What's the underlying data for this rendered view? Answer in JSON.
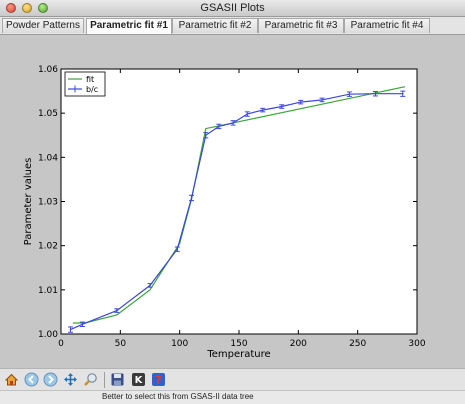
{
  "window": {
    "title": "GSASII Plots"
  },
  "tabs": [
    {
      "label": "Powder Patterns"
    },
    {
      "label": "Parametric fit #1"
    },
    {
      "label": "Parametric fit #2"
    },
    {
      "label": "Parametric fit #3"
    },
    {
      "label": "Parametric fit #4"
    }
  ],
  "active_tab": 1,
  "toolbar": {
    "buttons": [
      {
        "icon": "home-icon"
      },
      {
        "icon": "back-arrow-icon"
      },
      {
        "icon": "forward-arrow-icon"
      },
      {
        "icon": "pan-icon"
      },
      {
        "icon": "zoom-icon"
      },
      {
        "icon": "save-icon"
      },
      {
        "icon": "k-icon"
      },
      {
        "icon": "help-icon"
      }
    ]
  },
  "status": {
    "text": "Better to select this from GSAS-II data tree"
  },
  "chart_data": {
    "type": "line",
    "xlabel": "Temperature",
    "ylabel": "Parameter values",
    "xlim": [
      0,
      300
    ],
    "ylim": [
      1.0,
      1.06
    ],
    "xticks": [
      "0",
      "50",
      "100",
      "150",
      "200",
      "250",
      "300"
    ],
    "yticks": [
      "1.00",
      "1.01",
      "1.02",
      "1.03",
      "1.04",
      "1.05",
      "1.06"
    ],
    "legend_position": "top-left",
    "colors": {
      "fit": "#3aa63a",
      "bc": "#3d49d8"
    },
    "series": [
      {
        "name": "fit",
        "x": [
          10,
          20,
          47,
          75,
          100,
          110,
          122,
          145,
          290
        ],
        "y": [
          1.0025,
          1.0025,
          1.0043,
          1.01,
          1.0205,
          1.0305,
          1.0465,
          1.0478,
          1.056
        ]
      },
      {
        "name": "b/c",
        "x": [
          8,
          18,
          47,
          75,
          98,
          110,
          122,
          133,
          145,
          157,
          170,
          186,
          202,
          220,
          243,
          265,
          288
        ],
        "y": [
          1.001,
          1.0022,
          1.0053,
          1.011,
          1.0192,
          1.0308,
          1.045,
          1.047,
          1.0478,
          1.0498,
          1.0507,
          1.0515,
          1.0525,
          1.053,
          1.0543,
          1.0544,
          1.0544
        ],
        "err": [
          0.0006,
          0.0005,
          0.0004,
          0.0004,
          0.0005,
          0.0006,
          0.0006,
          0.0005,
          0.0005,
          0.0005,
          0.0004,
          0.0004,
          0.0004,
          0.0004,
          0.0005,
          0.0005,
          0.0006
        ]
      }
    ]
  }
}
